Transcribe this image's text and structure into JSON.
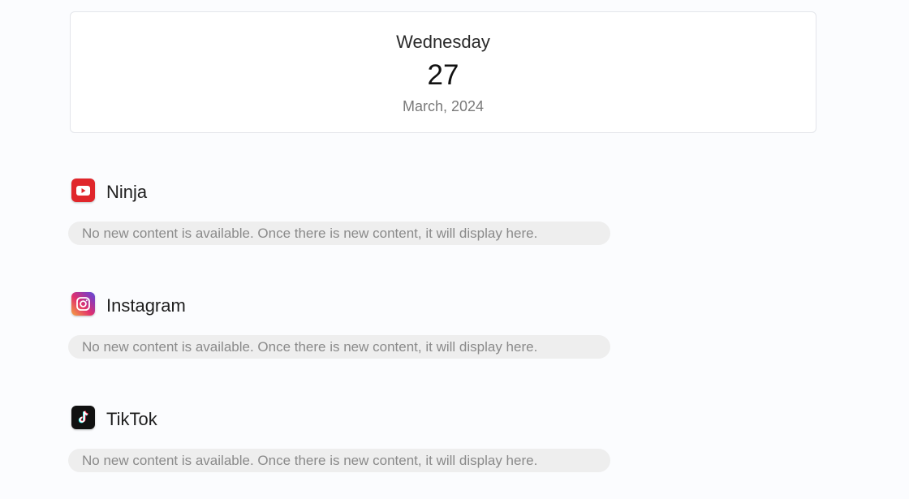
{
  "date_card": {
    "weekday": "Wednesday",
    "day": "27",
    "month_year": "March, 2024"
  },
  "sources": [
    {
      "name": "Ninja",
      "icon": "youtube-icon",
      "icon_color": "#e0262b",
      "empty_message": "No new content is available. Once there is new content, it will display here."
    },
    {
      "name": "Instagram",
      "icon": "instagram-icon",
      "icon_color": "#c13584",
      "empty_message": "No new content is available. Once there is new content, it will display here."
    },
    {
      "name": "TikTok",
      "icon": "tiktok-icon",
      "icon_color": "#111111",
      "empty_message": "No new content is available. Once there is new content, it will display here."
    }
  ]
}
